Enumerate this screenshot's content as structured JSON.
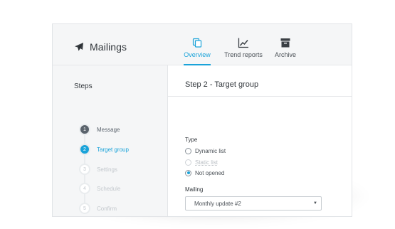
{
  "app": {
    "title": "Mailings",
    "brand_icon": "paper-plane-icon"
  },
  "nav": {
    "items": [
      {
        "label": "Overview",
        "icon": "copy-icon",
        "active": true
      },
      {
        "label": "Trend reports",
        "icon": "trend-chart-icon",
        "active": false
      },
      {
        "label": "Archive",
        "icon": "archive-box-icon",
        "active": false
      }
    ]
  },
  "sidebar": {
    "title": "Steps",
    "steps": [
      {
        "number": "1",
        "label": "Message",
        "state": "done"
      },
      {
        "number": "2",
        "label": "Target group",
        "state": "active"
      },
      {
        "number": "3",
        "label": "Settings",
        "state": "upcoming"
      },
      {
        "number": "4",
        "label": "Schedule",
        "state": "upcoming"
      },
      {
        "number": "5",
        "label": "Confirm",
        "state": "upcoming"
      }
    ]
  },
  "content": {
    "title": "Step 2 - Target group",
    "type_label": "Type",
    "type_options": [
      {
        "label": "Dynamic list",
        "checked": false,
        "disabled": false
      },
      {
        "label": "Static list",
        "checked": false,
        "disabled": true
      },
      {
        "label": "Not opened",
        "checked": true,
        "disabled": false
      }
    ],
    "mailing_label": "Mailing",
    "mailing_value": "Monthly update #2",
    "mailing_caret": "▼"
  },
  "colors": {
    "accent": "#1aa3d9",
    "done_step": "#5a636c",
    "header_bg": "#f5f6f7"
  }
}
